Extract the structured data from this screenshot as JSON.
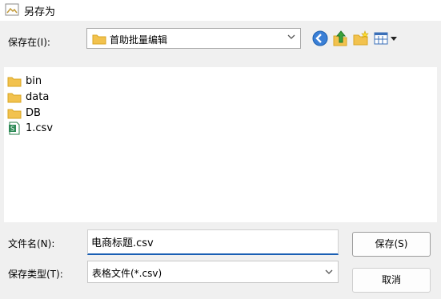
{
  "window": {
    "title": "另存为"
  },
  "location": {
    "label": "保存在(I):",
    "current_folder": "首助批量编辑"
  },
  "toolbar": {
    "buttons": [
      "back-icon",
      "up-folder-icon",
      "new-folder-icon",
      "view-menu-icon"
    ]
  },
  "files": [
    {
      "name": "bin",
      "icon": "folder-icon"
    },
    {
      "name": "data",
      "icon": "folder-icon"
    },
    {
      "name": "DB",
      "icon": "folder-icon"
    },
    {
      "name": "1.csv",
      "icon": "spreadsheet-file-icon"
    }
  ],
  "filename": {
    "label": "文件名(N):",
    "value": "电商标题.csv"
  },
  "filetype": {
    "label": "保存类型(T):",
    "value": "表格文件(*.csv)"
  },
  "buttons": {
    "save": "保存(S)",
    "cancel": "取消"
  },
  "colors": {
    "accent": "#1a5fb4",
    "folder": "#f2c24e",
    "background": "#f0f0f0"
  }
}
